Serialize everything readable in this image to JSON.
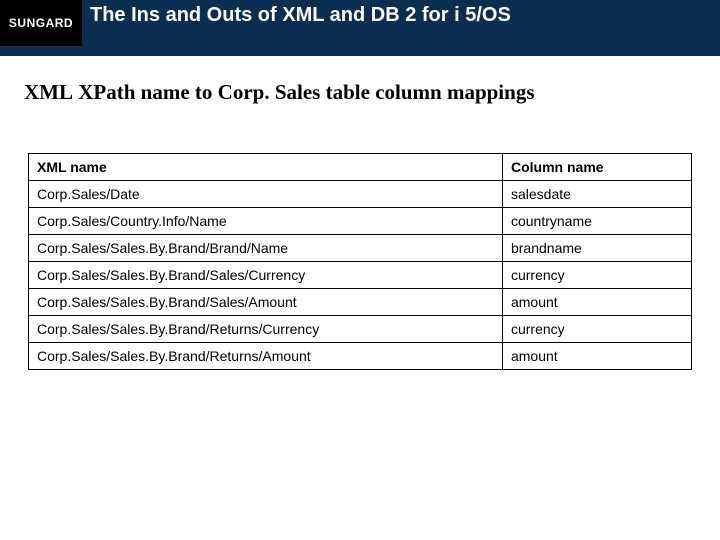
{
  "header": {
    "logo": "SUNGARD",
    "title": "The Ins and Outs of XML and DB 2 for i 5/OS"
  },
  "section": {
    "title_parts": [
      "XML",
      "XPath",
      "name",
      "to",
      "Corp.",
      "Sales",
      "table",
      "column",
      "mappings"
    ]
  },
  "table": {
    "headers": {
      "xml": "XML name",
      "col": "Column name"
    },
    "rows": [
      {
        "xml": "Corp.Sales/Date",
        "col": "salesdate"
      },
      {
        "xml": "Corp.Sales/Country.Info/Name",
        "col": "countryname"
      },
      {
        "xml": "Corp.Sales/Sales.By.Brand/Brand/Name",
        "col": "brandname"
      },
      {
        "xml": "Corp.Sales/Sales.By.Brand/Sales/Currency",
        "col": "currency"
      },
      {
        "xml": "Corp.Sales/Sales.By.Brand/Sales/Amount",
        "col": "amount"
      },
      {
        "xml": "Corp.Sales/Sales.By.Brand/Returns/Currency",
        "col": "currency"
      },
      {
        "xml": "Corp.Sales/Sales.By.Brand/Returns/Amount",
        "col": "amount"
      }
    ]
  }
}
